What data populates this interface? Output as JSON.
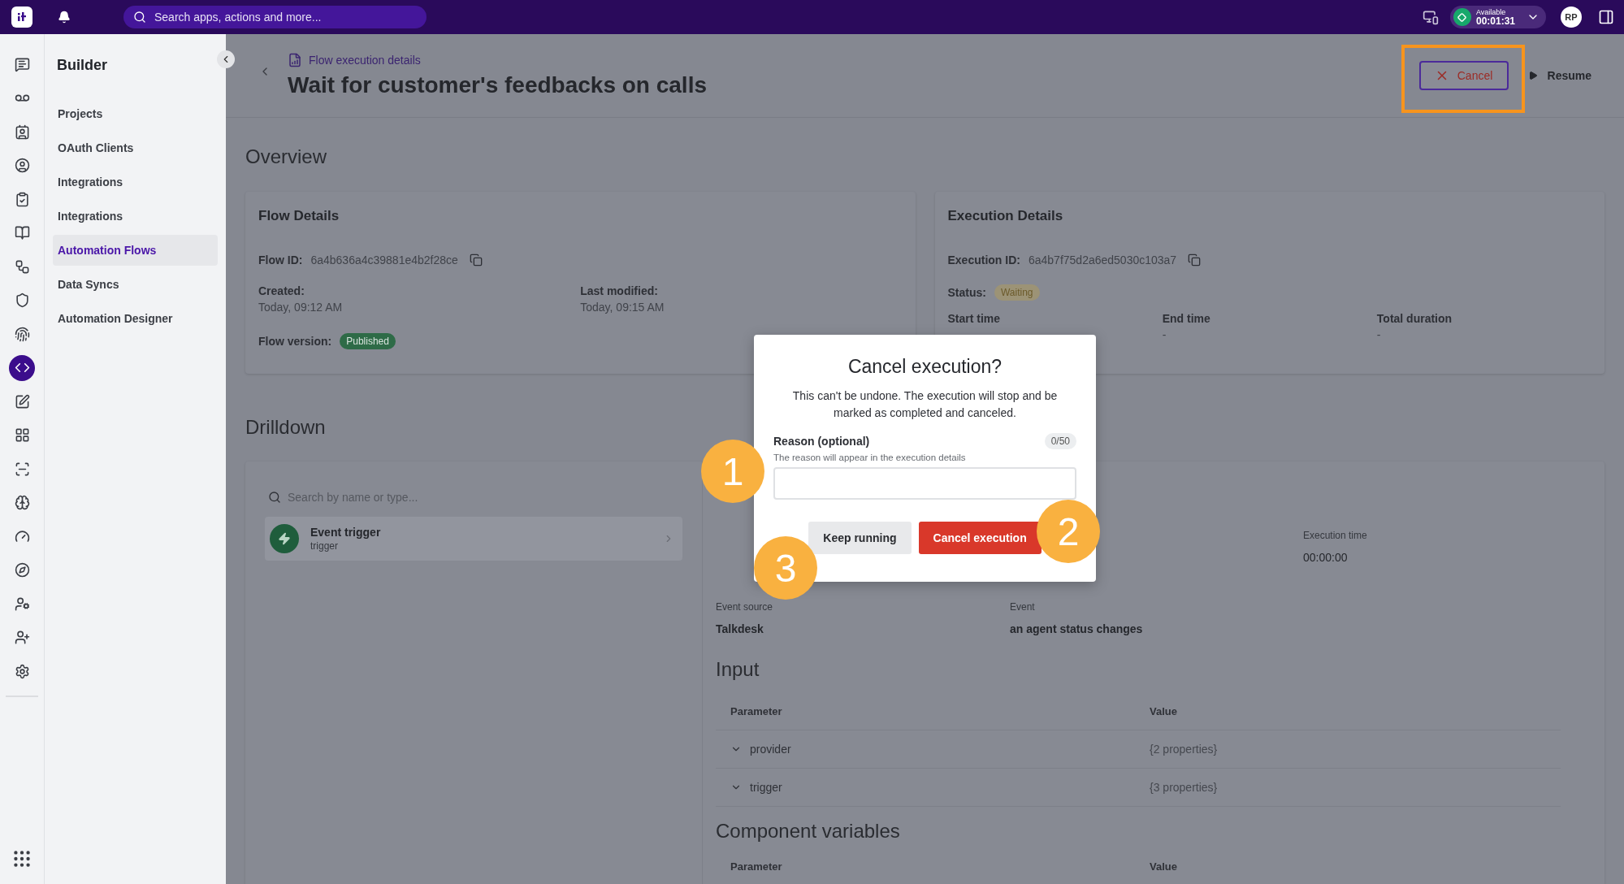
{
  "top_bar": {
    "search": {
      "placeholder": "Search apps, actions and more..."
    },
    "status": {
      "label": "Available",
      "timer": "00:01:31"
    },
    "avatar": "RP"
  },
  "rail": [
    {
      "selected": false
    },
    {
      "selected": false
    },
    {
      "selected": false
    },
    {
      "selected": false
    },
    {
      "selected": false
    },
    {
      "selected": false
    },
    {
      "selected": false
    },
    {
      "selected": false
    },
    {
      "selected": false
    },
    {
      "selected": true
    },
    {
      "selected": false
    },
    {
      "selected": false
    },
    {
      "selected": false
    },
    {
      "selected": false
    },
    {
      "selected": false
    },
    {
      "selected": false
    },
    {
      "selected": false
    },
    {
      "selected": false
    },
    {
      "selected": false
    }
  ],
  "sidebar": {
    "title": "Builder",
    "items": [
      {
        "label": "Projects",
        "selected": false
      },
      {
        "label": "OAuth Clients",
        "selected": false
      },
      {
        "label": "Integrations",
        "selected": false
      },
      {
        "label": "Integrations",
        "selected": false
      },
      {
        "label": "Automation Flows",
        "selected": true
      },
      {
        "label": "Data Syncs",
        "selected": false
      },
      {
        "label": "Automation Designer",
        "selected": false
      }
    ]
  },
  "header": {
    "breadcrumb": "Flow execution details",
    "title": "Wait for customer's feedbacks on calls",
    "actions": [
      {
        "label": "Cancel",
        "kind": "cancel",
        "highlighted": true
      },
      {
        "label": "Resume",
        "kind": "resume",
        "highlighted": false
      }
    ]
  },
  "overview": {
    "heading": "Overview",
    "flow_details": {
      "title": "Flow Details",
      "flow_id_label": "Flow ID:",
      "flow_id": "6a4b636a4c39881e4b2f28ce",
      "created_label": "Created:",
      "created": "Today, 09:12 AM",
      "modified_label": "Last modified:",
      "modified": "Today, 09:15 AM",
      "version_label": "Flow version:",
      "version": "Published"
    },
    "execution_details": {
      "title": "Execution Details",
      "execution_id_label": "Execution ID:",
      "execution_id": "6a4b7f75d2a6ed5030c103a7",
      "status_label": "Status:",
      "status": "Waiting",
      "columns": [
        {
          "label": "Start time"
        },
        {
          "label": "End time",
          "value": "-"
        },
        {
          "label": "Total duration",
          "value": "-"
        }
      ]
    }
  },
  "drilldown": {
    "heading": "Drilldown",
    "search": {
      "placeholder": "Search by name or type..."
    },
    "steps": [
      {
        "name": "Event trigger",
        "type": "trigger"
      }
    ],
    "details": {
      "execution_time_label": "Execution time",
      "execution_time": "00:00:00",
      "event_source_label": "Event source",
      "event_source": "Talkdesk",
      "event_label": "Event",
      "event": "an agent status changes",
      "input": {
        "heading": "Input",
        "columns": [
          "Parameter",
          "Value"
        ],
        "rows": [
          {
            "parameter": "provider",
            "value": "{2 properties}",
            "expanded": false
          },
          {
            "parameter": "trigger",
            "value": "{3 properties}",
            "expanded": false
          }
        ]
      },
      "component_variables": {
        "heading": "Component variables",
        "columns": [
          "Parameter",
          "Value"
        ]
      }
    }
  },
  "dialog": {
    "title": "Cancel execution?",
    "message": "This can't be undone. The execution will stop and be marked as completed and canceled.",
    "field_label": "Reason (optional)",
    "counter": "0/50",
    "hint": "The reason will appear in the execution details",
    "buttons": [
      {
        "label": "Keep running",
        "kind": "secondary"
      },
      {
        "label": "Cancel execution",
        "kind": "danger"
      }
    ]
  },
  "callouts": [
    "1",
    "2",
    "3"
  ]
}
